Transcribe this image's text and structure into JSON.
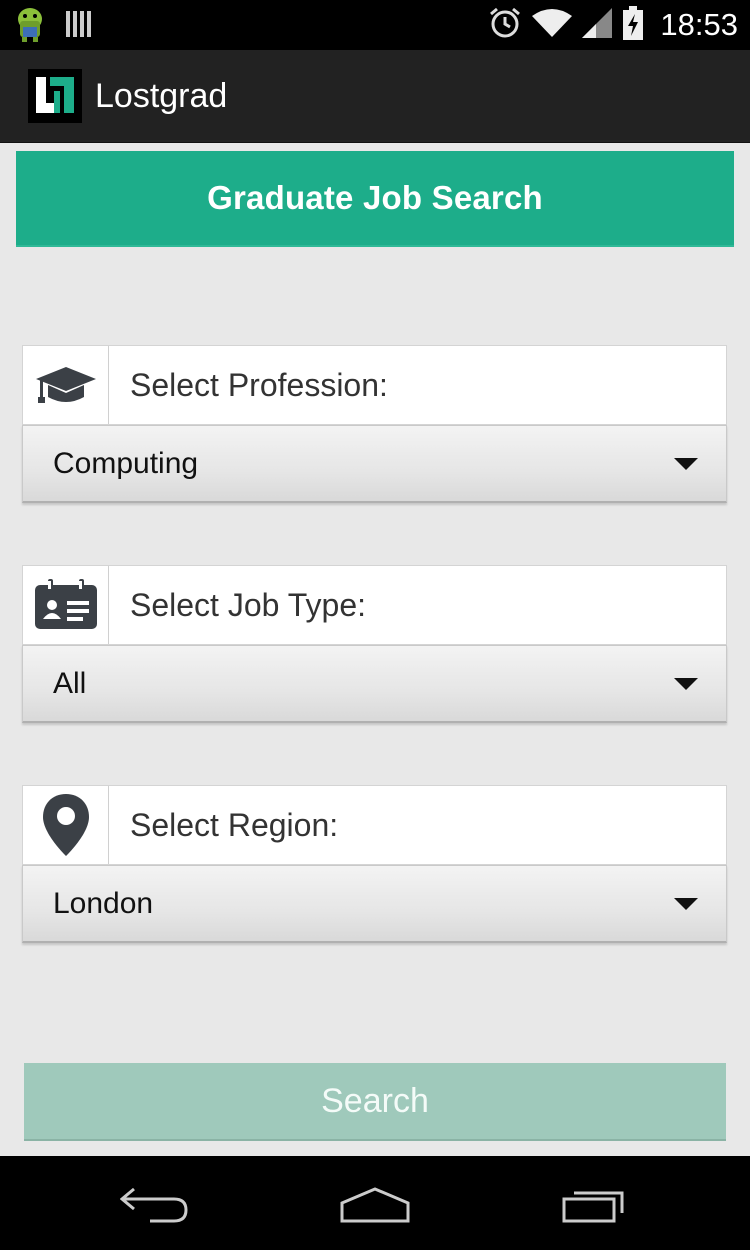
{
  "status_bar": {
    "time": "18:53",
    "icons": [
      "android-debug-icon",
      "storage-icon",
      "alarm-icon",
      "wifi-icon",
      "signal-icon",
      "battery-charging-icon"
    ]
  },
  "action_bar": {
    "app_title": "Lostgrad",
    "logo_icon": "lostgrad-logo-icon"
  },
  "banner": {
    "title": "Graduate Job Search",
    "color": "#1dad8a"
  },
  "selectors": [
    {
      "label": "Select Profession:",
      "value": "Computing",
      "icon": "graduation-cap-icon"
    },
    {
      "label": "Select Job Type:",
      "value": "All",
      "icon": "id-card-icon"
    },
    {
      "label": "Select Region:",
      "value": "London",
      "icon": "map-pin-icon"
    }
  ],
  "search_button": {
    "label": "Search",
    "color": "#9fc9bb"
  },
  "nav_bar": {
    "icons": [
      "back-icon",
      "home-icon",
      "recent-apps-icon"
    ]
  }
}
